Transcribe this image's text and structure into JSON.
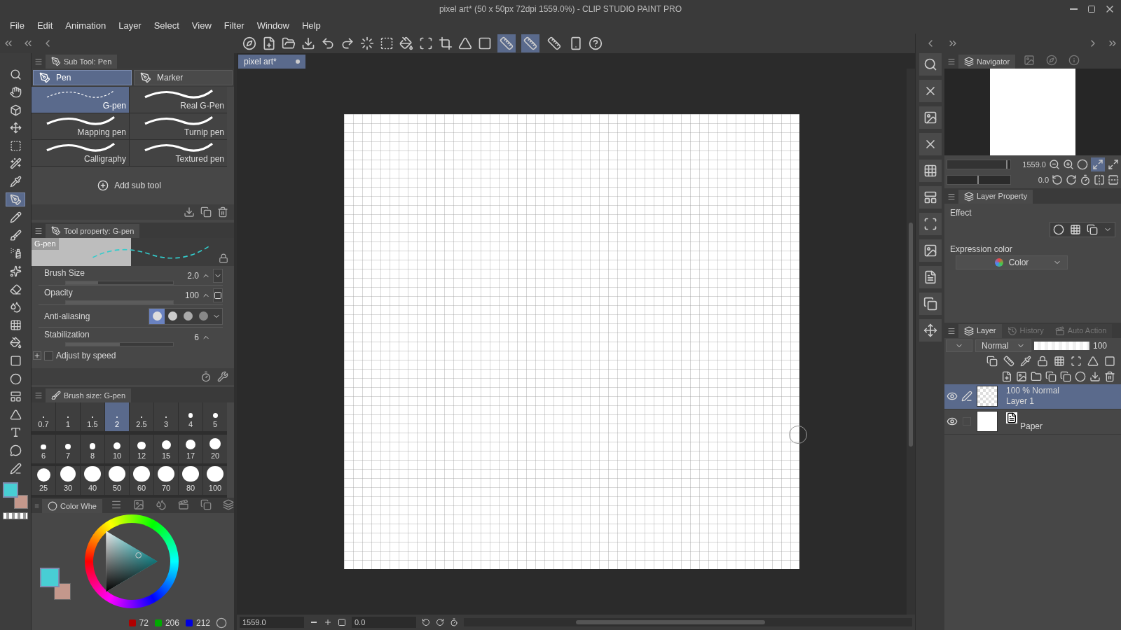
{
  "window": {
    "title": "pixel art* (50 x 50px 72dpi 1559.0%) - CLIP STUDIO PAINT PRO"
  },
  "menu": [
    "File",
    "Edit",
    "Animation",
    "Layer",
    "Select",
    "View",
    "Filter",
    "Window",
    "Help"
  ],
  "toolbar": {
    "snap_toggles": [
      {
        "on": true
      },
      {
        "on": true
      },
      {
        "on": false
      }
    ]
  },
  "tools": [
    {
      "kind": "zoom",
      "selected": false
    },
    {
      "kind": "hand",
      "selected": false
    },
    {
      "kind": "object",
      "selected": false
    },
    {
      "kind": "move",
      "selected": false
    },
    {
      "kind": "marquee",
      "selected": false
    },
    {
      "kind": "wand",
      "selected": false
    },
    {
      "kind": "eyedropper",
      "selected": false
    },
    {
      "kind": "pen",
      "selected": true
    },
    {
      "kind": "pencil",
      "selected": false
    },
    {
      "kind": "brush",
      "selected": false
    },
    {
      "kind": "airbrush",
      "selected": false
    },
    {
      "kind": "decoration",
      "selected": false
    },
    {
      "kind": "eraser",
      "selected": false
    },
    {
      "kind": "blend",
      "selected": false
    },
    {
      "kind": "grid",
      "selected": false
    },
    {
      "kind": "fill",
      "selected": false
    },
    {
      "kind": "gradient",
      "selected": false
    },
    {
      "kind": "shape",
      "selected": false
    },
    {
      "kind": "frame",
      "selected": false
    },
    {
      "kind": "ruler",
      "selected": false
    },
    {
      "kind": "text",
      "selected": false
    },
    {
      "kind": "balloon",
      "selected": false
    },
    {
      "kind": "line",
      "selected": false
    }
  ],
  "color_swatches": [
    {
      "kind": "main",
      "color": "#48ced4"
    },
    {
      "kind": "sub",
      "color": "#c4988c"
    }
  ],
  "sub_tool": {
    "title": "Sub Tool: Pen",
    "groups": [
      {
        "label": "Pen",
        "selected": true
      },
      {
        "label": "Marker",
        "selected": false
      }
    ],
    "items": [
      {
        "label": "G-pen",
        "selected": true
      },
      {
        "label": "Real G-Pen",
        "selected": false
      },
      {
        "label": "Mapping pen",
        "selected": false
      },
      {
        "label": "Turnip pen",
        "selected": false
      },
      {
        "label": "Calligraphy",
        "selected": false
      },
      {
        "label": "Textured pen",
        "selected": false
      }
    ],
    "add_label": "Add sub tool"
  },
  "tool_property": {
    "title": "Tool property: G-pen",
    "preview_label": "G-pen",
    "brush_size": {
      "label": "Brush Size",
      "value": "2.0",
      "level": 0.3
    },
    "opacity": {
      "label": "Opacity",
      "value": "100",
      "level": 1.0
    },
    "anti_aliasing": {
      "label": "Anti-aliasing",
      "options": [
        {
          "selected": true
        },
        {
          "selected": false
        },
        {
          "selected": false
        },
        {
          "selected": false
        }
      ]
    },
    "stabilization": {
      "label": "Stabilization",
      "value": "6",
      "level": 0.5
    },
    "adjust_by_speed": {
      "label": "Adjust by speed",
      "checked": false
    }
  },
  "brush_size_panel": {
    "title": "Brush size: G-pen",
    "sizes": [
      {
        "label": "0.7",
        "selected": false
      },
      {
        "label": "1",
        "selected": false
      },
      {
        "label": "1.5",
        "selected": false
      },
      {
        "label": "2",
        "selected": true
      },
      {
        "label": "2.5",
        "selected": false
      },
      {
        "label": "3",
        "selected": false
      },
      {
        "label": "4",
        "selected": false
      },
      {
        "label": "5",
        "selected": false
      },
      {
        "label": "6",
        "selected": false
      },
      {
        "label": "7",
        "selected": false
      },
      {
        "label": "8",
        "selected": false
      },
      {
        "label": "10",
        "selected": false
      },
      {
        "label": "12",
        "selected": false
      },
      {
        "label": "15",
        "selected": false
      },
      {
        "label": "17",
        "selected": false
      },
      {
        "label": "20",
        "selected": false
      },
      {
        "label": "25",
        "selected": false
      },
      {
        "label": "30",
        "selected": false
      },
      {
        "label": "40",
        "selected": false
      },
      {
        "label": "50",
        "selected": false
      },
      {
        "label": "60",
        "selected": false
      },
      {
        "label": "70",
        "selected": false
      },
      {
        "label": "80",
        "selected": false
      },
      {
        "label": "100",
        "selected": false
      }
    ]
  },
  "color_panel": {
    "tab": "Color Whe",
    "r": "72",
    "g": "206",
    "b": "212"
  },
  "document_tab": {
    "label": "pixel art*"
  },
  "status_bar": {
    "zoom": "1559.0",
    "rotation": "0.0"
  },
  "navigator": {
    "tab": "Navigator",
    "zoom": "1559.0",
    "zoom_slider": {
      "level": 0.95
    },
    "rotation": "0.0",
    "rotation_slider": {
      "level": 0.5
    },
    "fit_on": true
  },
  "layer_property": {
    "tab": "Layer Property",
    "effect_label": "Effect",
    "expression_label": "Expression color",
    "expression_value": "Color"
  },
  "layer_panel": {
    "tabs": [
      {
        "label": "Layer",
        "selected": true
      },
      {
        "label": "History",
        "selected": false
      },
      {
        "label": "Auto Action",
        "selected": false
      }
    ],
    "blend_mode": "Normal",
    "opacity": "100",
    "opacity_slider": {
      "level": 1.0
    },
    "layers": [
      {
        "kind": "raster",
        "info": "100 % Normal",
        "name": "Layer 1",
        "selected": true,
        "visible": true
      },
      {
        "kind": "paper",
        "name": "Paper",
        "selected": false,
        "visible": true
      }
    ]
  }
}
